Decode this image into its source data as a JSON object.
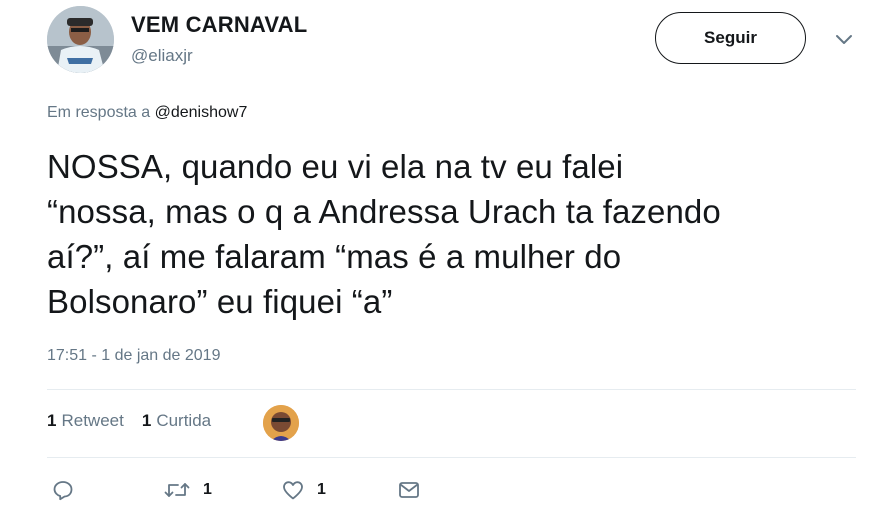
{
  "author": {
    "display_name": "VEM CARNAVAL",
    "handle": "@eliaxjr"
  },
  "follow_button": {
    "label": "Seguir"
  },
  "reply_context": {
    "prefix": "Em resposta a",
    "mention": "@denishow7"
  },
  "tweet": {
    "text_lines": [
      "NOSSA, quando eu vi ela na tv eu falei",
      "“nossa, mas o q a Andressa Urach ta fazendo",
      "aí?”, aí me falaram “mas é a mulher do",
      "Bolsonaro” eu fiquei “a”"
    ],
    "timestamp": "17:51 - 1 de jan de 2019"
  },
  "stats": {
    "retweets_count": "1",
    "retweets_label": "Retweet",
    "likes_count": "1",
    "likes_label": "Curtida"
  },
  "actions": {
    "reply": {
      "icon": "reply-icon"
    },
    "retweet": {
      "icon": "retweet-icon",
      "count": "1"
    },
    "like": {
      "icon": "heart-icon",
      "count": "1"
    },
    "dm": {
      "icon": "envelope-icon"
    }
  },
  "colors": {
    "text": "#14171a",
    "secondary": "#657786",
    "divider": "#e6ecf0"
  }
}
